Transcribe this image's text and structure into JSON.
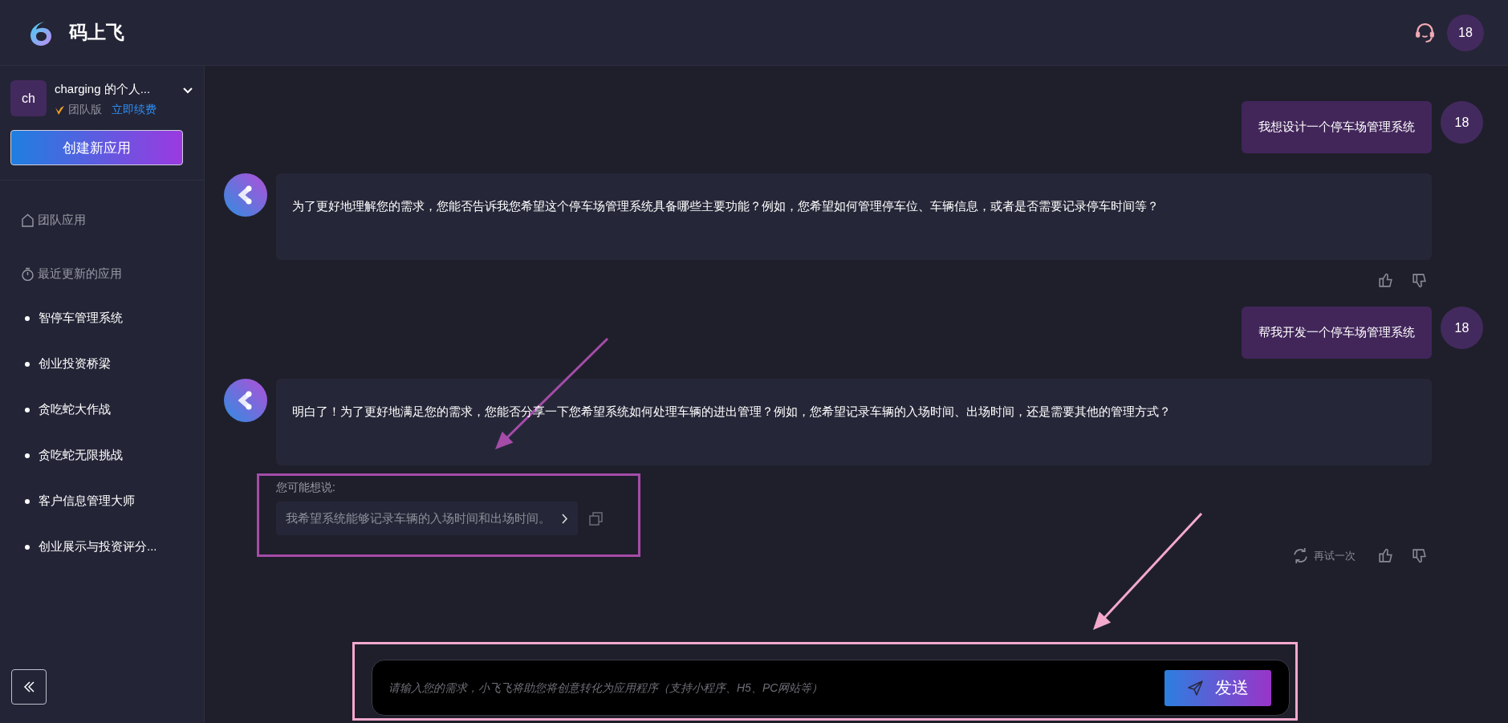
{
  "header": {
    "app_name": "码上飞",
    "user_avatar": "18"
  },
  "workspace": {
    "avatar": "ch",
    "name": "charging 的个人...",
    "plan": "团队版",
    "renew_link": "立即续费"
  },
  "create_button": "创建新应用",
  "team_apps": {
    "label": "团队应用"
  },
  "recent_apps": {
    "heading": "最近更新的应用",
    "items": [
      "智停车管理系统",
      "创业投资桥梁",
      "贪吃蛇大作战",
      "贪吃蛇无限挑战",
      "客户信息管理大师",
      "创业展示与投资评分..."
    ]
  },
  "messages": [
    {
      "kind": "user",
      "text": "我想设计一个停车场管理系统",
      "avatar": "18"
    },
    {
      "kind": "assistant",
      "text": "为了更好地理解您的需求，您能否告诉我您希望这个停车场管理系统具备哪些主要功能？例如，您希望如何管理停车位、车辆信息，或者是否需要记录停车时间等？",
      "feedback": true
    },
    {
      "kind": "user",
      "text": "帮我开发一个停车场管理系统",
      "avatar": "18"
    },
    {
      "kind": "assistant",
      "text": "明白了！为了更好地满足您的需求，您能否分享一下您希望系统如何处理车辆的进出管理？例如，您希望记录车辆的入场时间、出场时间，还是需要其他的管理方式？",
      "suggestions": {
        "label": "您可能想说:",
        "items": [
          "我希望系统能够记录车辆的入场时间和出场时间。"
        ]
      },
      "retry": "再试一次",
      "feedback": true
    }
  ],
  "composer": {
    "placeholder": "请输入您的需求，小飞飞将助您将创意转化为应用程序（支持小程序、H5、PC网站等）",
    "send_button": "发送"
  },
  "annotations": [
    {
      "kind": "arrow",
      "color": "#a54ca8"
    },
    {
      "kind": "box",
      "color": "#a54ca8"
    },
    {
      "kind": "arrow",
      "color": "#f3a9cc"
    },
    {
      "kind": "box",
      "color": "#f3a9cc"
    }
  ]
}
